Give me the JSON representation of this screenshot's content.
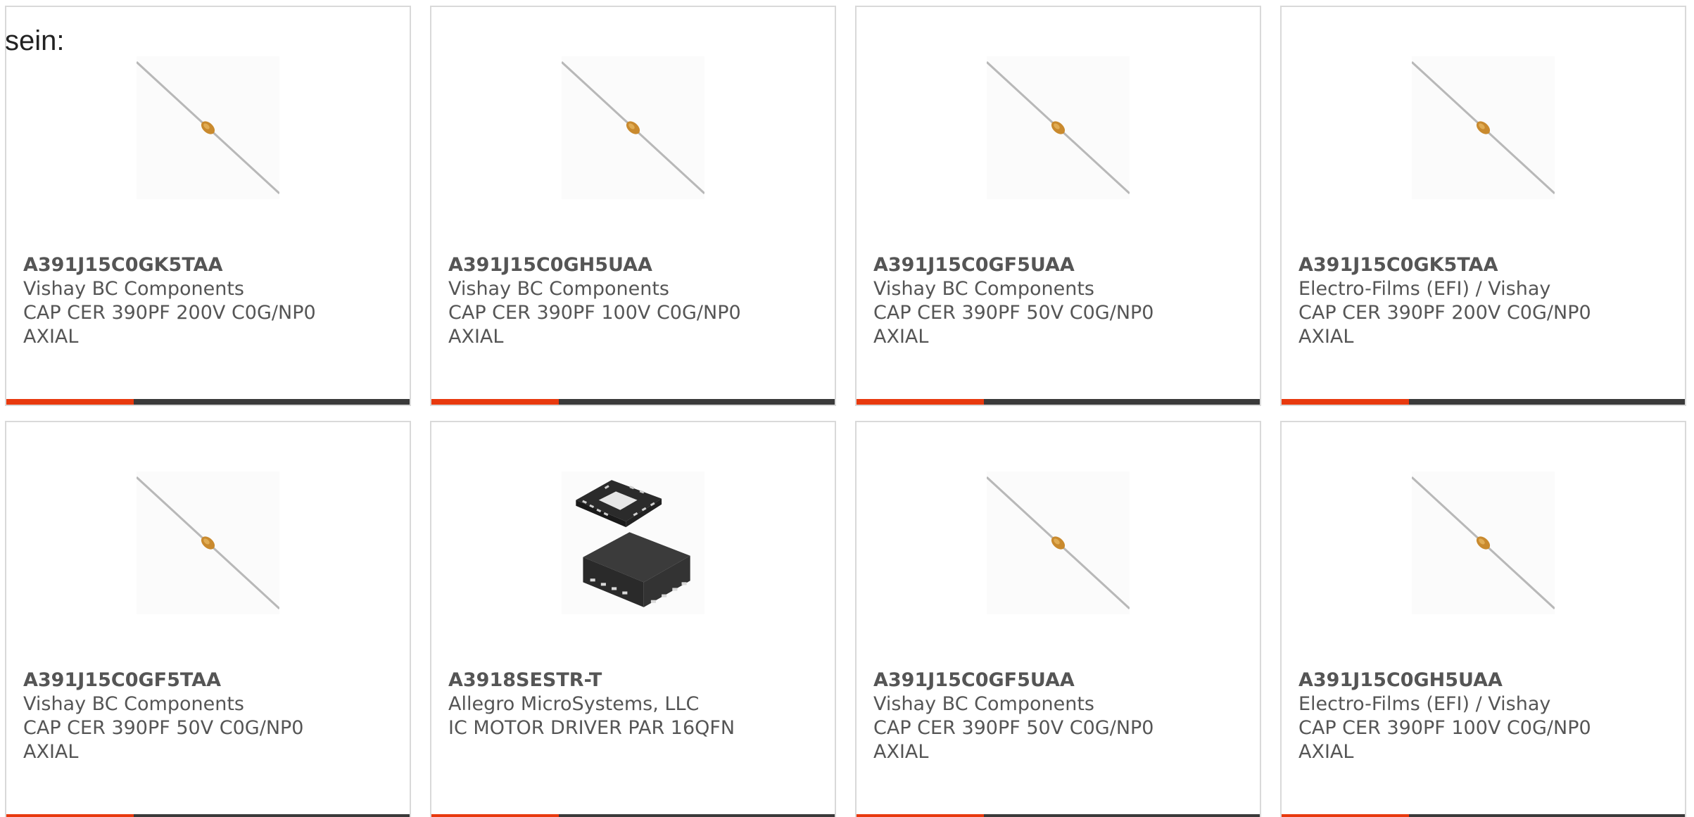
{
  "heading": "sein:",
  "cards": [
    {
      "part": "A391J15C0GK5TAA",
      "manufacturer": "Vishay BC Components",
      "desc1": "CAP CER 390PF 200V C0G/NP0",
      "desc2": "AXIAL",
      "image": "axial-capacitor"
    },
    {
      "part": "A391J15C0GH5UAA",
      "manufacturer": "Vishay BC Components",
      "desc1": "CAP CER 390PF 100V C0G/NP0",
      "desc2": "AXIAL",
      "image": "axial-capacitor"
    },
    {
      "part": "A391J15C0GF5UAA",
      "manufacturer": "Vishay BC Components",
      "desc1": "CAP CER 390PF 50V C0G/NP0",
      "desc2": "AXIAL",
      "image": "axial-capacitor"
    },
    {
      "part": "A391J15C0GK5TAA",
      "manufacturer": "Electro-Films (EFI) / Vishay",
      "desc1": "CAP CER 390PF 200V C0G/NP0",
      "desc2": "AXIAL",
      "image": "axial-capacitor"
    },
    {
      "part": "A391J15C0GF5TAA",
      "manufacturer": "Vishay BC Components",
      "desc1": "CAP CER 390PF 50V C0G/NP0",
      "desc2": "AXIAL",
      "image": "axial-capacitor"
    },
    {
      "part": "A3918SESTR-T",
      "manufacturer": "Allegro MicroSystems, LLC",
      "desc1": "IC MOTOR DRIVER PAR 16QFN",
      "desc2": "",
      "image": "qfn-chip"
    },
    {
      "part": "A391J15C0GF5UAA",
      "manufacturer": "Vishay BC Components",
      "desc1": "CAP CER 390PF 50V C0G/NP0",
      "desc2": "AXIAL",
      "image": "axial-capacitor"
    },
    {
      "part": "A391J15C0GH5UAA",
      "manufacturer": "Electro-Films (EFI) / Vishay",
      "desc1": "CAP CER 390PF 100V C0G/NP0",
      "desc2": "AXIAL",
      "image": "axial-capacitor"
    }
  ],
  "colors": {
    "accent": "#e8390e",
    "bar": "#3a3a3a",
    "border": "#d9d9d9",
    "text": "#555555"
  }
}
